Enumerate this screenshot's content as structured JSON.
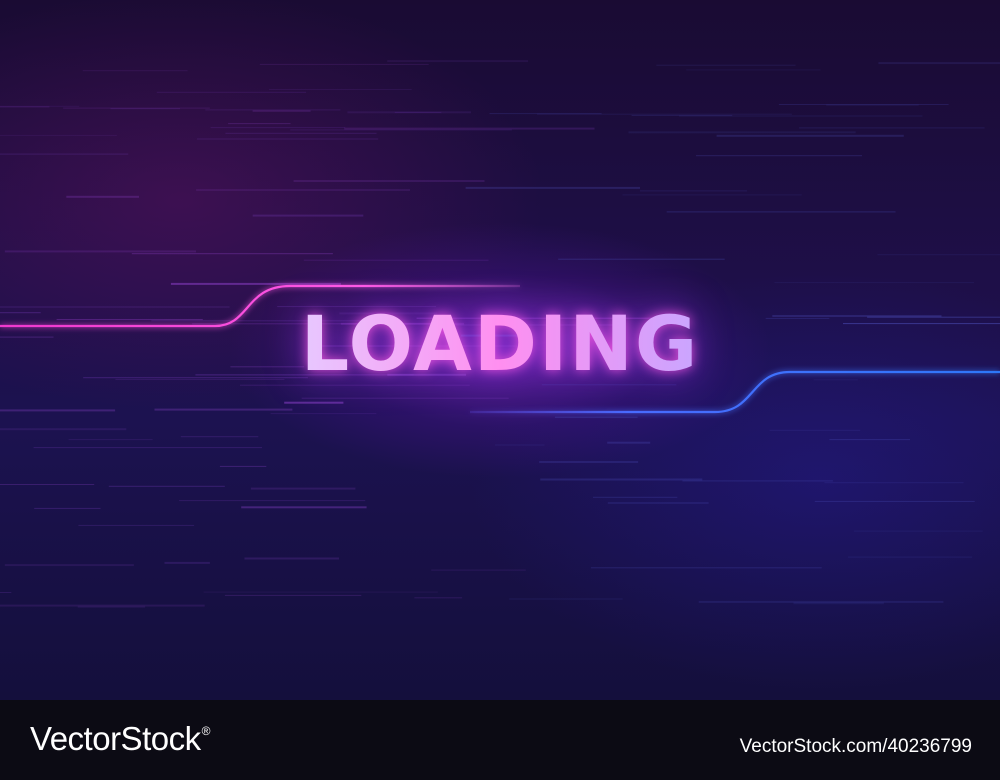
{
  "main": {
    "loading_text": "LOADING"
  },
  "footer": {
    "brand": "VectorStock",
    "registered_mark": "®",
    "image_id": "VectorStock.com/40236799"
  },
  "colors": {
    "background_top": "#1a0b33",
    "background_bottom": "#140f3c",
    "glow_pink": "#ff3cd8",
    "glow_blue": "#3c6bff",
    "footer_bg": "#0c0b14"
  }
}
